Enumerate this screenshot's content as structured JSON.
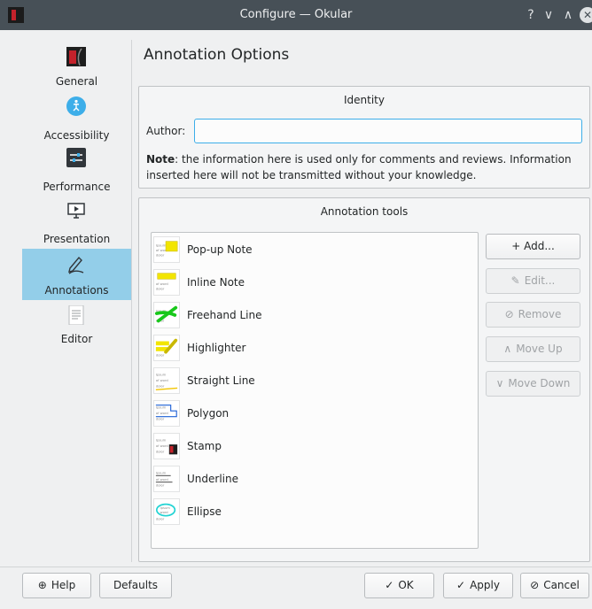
{
  "window": {
    "title": "Configure — Okular",
    "controls": {
      "help": "?",
      "minimize": "∨",
      "maximize": "∧",
      "close": "✕"
    }
  },
  "sidebar": {
    "items": [
      {
        "label": "General",
        "icon": "okular-logo-icon"
      },
      {
        "label": "Accessibility",
        "icon": "accessibility-icon"
      },
      {
        "label": "Performance",
        "icon": "performance-icon"
      },
      {
        "label": "Presentation",
        "icon": "presentation-icon"
      },
      {
        "label": "Annotations",
        "icon": "annotation-pen-icon",
        "active": true
      },
      {
        "label": "Editor",
        "icon": "editor-document-icon"
      }
    ]
  },
  "page": {
    "title": "Annotation Options"
  },
  "identity": {
    "group_title": "Identity",
    "author_label": "Author:",
    "author_value": "",
    "note_bold": "Note",
    "note_text": ": the information here is used only for comments and reviews. Information inserted here will not be transmitted without your knowledge."
  },
  "tools": {
    "group_title": "Annotation tools",
    "items": [
      {
        "label": "Pop-up Note",
        "icon": "popup-note-icon"
      },
      {
        "label": "Inline Note",
        "icon": "inline-note-icon"
      },
      {
        "label": "Freehand Line",
        "icon": "freehand-line-icon"
      },
      {
        "label": "Highlighter",
        "icon": "highlighter-icon"
      },
      {
        "label": "Straight Line",
        "icon": "straight-line-icon"
      },
      {
        "label": "Polygon",
        "icon": "polygon-icon"
      },
      {
        "label": "Stamp",
        "icon": "stamp-icon"
      },
      {
        "label": "Underline",
        "icon": "underline-icon"
      },
      {
        "label": "Ellipse",
        "icon": "ellipse-icon"
      }
    ],
    "buttons": {
      "add": "+ Add...",
      "edit": "Edit...",
      "remove": "Remove",
      "move_up": "Move Up",
      "move_down": "Move Down"
    }
  },
  "footer": {
    "help": "Help",
    "defaults": "Defaults",
    "ok": "OK",
    "apply": "Apply",
    "cancel": "Cancel"
  },
  "colors": {
    "accent": "#3daee9",
    "selection": "#93cee9",
    "titlebar": "#475057"
  }
}
